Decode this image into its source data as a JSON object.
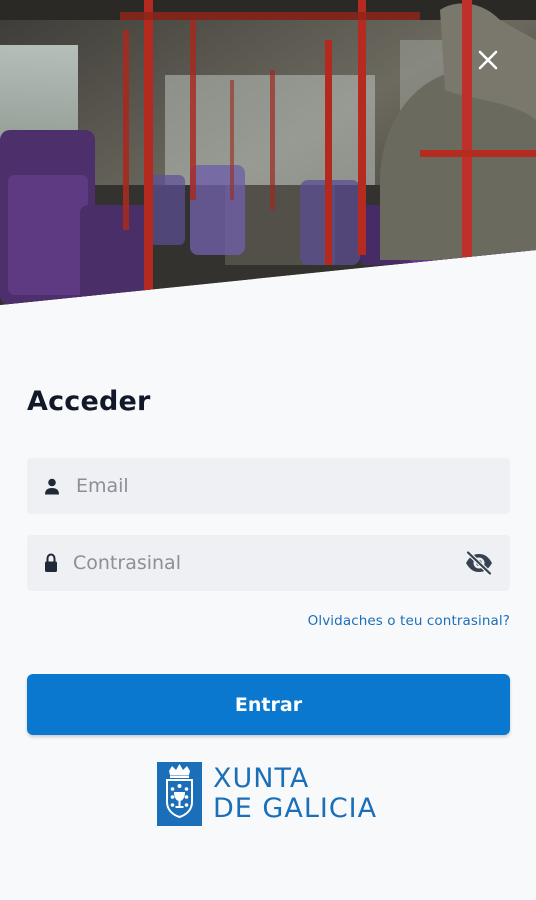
{
  "close_icon": "close-icon",
  "login": {
    "title": "Acceder",
    "email": {
      "placeholder": "Email",
      "value": "",
      "icon": "user-icon"
    },
    "password": {
      "placeholder": "Contrasinal",
      "value": "",
      "icon": "lock-icon",
      "toggle_icon": "eye-off-icon"
    },
    "forgot_link": "Olvidaches o teu contrasinal?",
    "submit_label": "Entrar"
  },
  "logo": {
    "line1": "XUNTA",
    "line2": "DE GALICIA"
  },
  "colors": {
    "accent": "#0a78cf",
    "link": "#1b6fb8",
    "field_bg": "#eef0f4",
    "page_bg": "#f8f9fb"
  }
}
